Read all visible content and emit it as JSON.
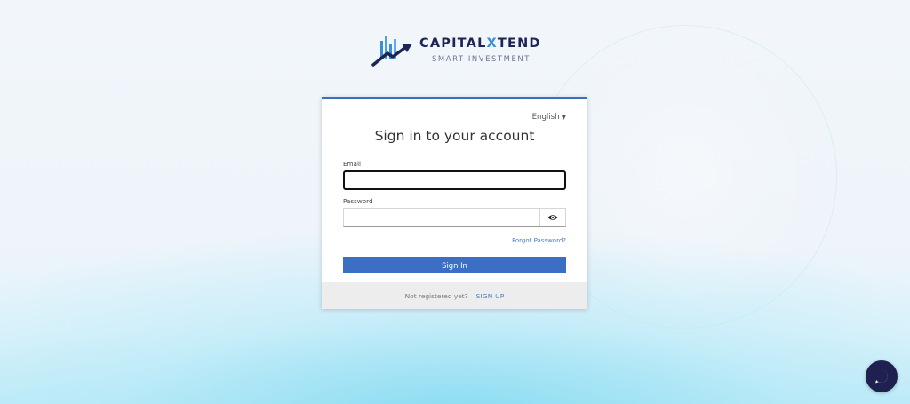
{
  "brand": {
    "name_main": "CAPITAL",
    "name_x": "X",
    "name_tail": "TEND",
    "tagline": "SMART INVESTMENT"
  },
  "login": {
    "language": "English",
    "heading": "Sign in to your account",
    "email_label": "Email",
    "email_value": "",
    "password_label": "Password",
    "password_value": "",
    "forgot_link": "Forgot Password?",
    "signin_button": "Sign In"
  },
  "footer": {
    "question": "Not registered yet?",
    "signup_link": "SIGN UP"
  },
  "colors": {
    "accent": "#3a6fc4",
    "brand_dark": "#1d2456",
    "chat_button": "#1e2150"
  },
  "icons": {
    "password_toggle": "eye-icon",
    "language_caret": "caret-down-icon",
    "chat": "chat-bubble-icon"
  }
}
